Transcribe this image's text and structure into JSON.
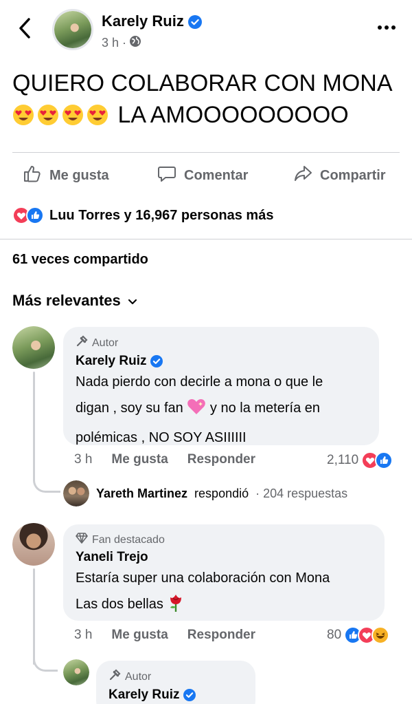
{
  "post": {
    "author": "Karely Ruiz",
    "time": "3 h ·",
    "text_line1": "QUIERO COLABORAR CON MONA",
    "text_line2": "LA AMOOOOOOOOO"
  },
  "actions": {
    "like": "Me gusta",
    "comment": "Comentar",
    "share": "Compartir"
  },
  "reactions_summary": "Luu Torres y 16,967 personas más",
  "shares": "61 veces compartido",
  "sort_label": "Más relevantes",
  "comments": [
    {
      "badge": "Autor",
      "name": "Karely Ruiz",
      "text_line1": "Nada pierdo con decirle a mona o que le",
      "text_line2a": "digan , soy su fan",
      "text_line2b": "y no la metería en",
      "text_line3": "polémicas , NO SOY ASIIIIII",
      "time": "3 h",
      "like": "Me gusta",
      "reply": "Responder",
      "reactions": "2,110",
      "replies": {
        "name": "Yareth Martinez",
        "verb": "respondió",
        "count": "· 204 respuestas"
      }
    },
    {
      "badge": "Fan destacado",
      "name": "Yaneli Trejo",
      "text_line1": "Estaría super una colaboración con Mona",
      "text_line2": "Las dos bellas",
      "time": "3 h",
      "like": "Me gusta",
      "reply": "Responder",
      "reactions": "80"
    }
  ],
  "nested_reply": {
    "badge": "Autor",
    "name": "Karely Ruiz"
  },
  "colors": {
    "brand_blue": "#1877f2",
    "love_red": "#f33e58",
    "haha_yellow": "#f7b125",
    "secondary_text": "#65676b"
  }
}
